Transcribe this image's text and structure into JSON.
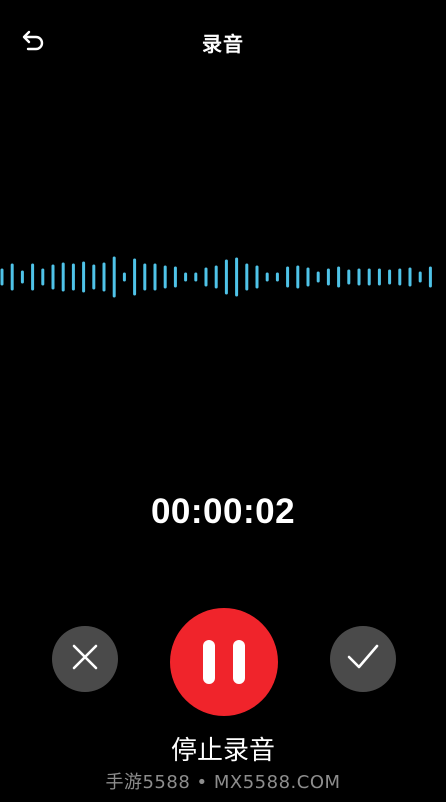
{
  "header": {
    "title": "录音",
    "back_icon": "undo-arrow-icon"
  },
  "recording": {
    "elapsed": "00:00:02",
    "waveform_color": "#4fc3e8",
    "waveform_levels": [
      0.35,
      0.6,
      0.25,
      0.6,
      0.35,
      0.55,
      0.65,
      0.6,
      0.7,
      0.55,
      0.65,
      0.95,
      0.15,
      0.85,
      0.6,
      0.6,
      0.5,
      0.45,
      0.15,
      0.15,
      0.4,
      0.5,
      0.8,
      0.9,
      0.6,
      0.5,
      0.15,
      0.15,
      0.45,
      0.5,
      0.4,
      0.2,
      0.35,
      0.45,
      0.3,
      0.35,
      0.35,
      0.35,
      0.3,
      0.35,
      0.4,
      0.2,
      0.45
    ]
  },
  "controls": {
    "cancel_icon": "close-icon",
    "pause_icon": "pause-icon",
    "confirm_icon": "checkmark-icon",
    "pause_color": "#f0242b",
    "secondary_color": "#4a4a4a",
    "stop_label": "停止录音"
  },
  "watermark": "手游5588 • MX5588.COM"
}
